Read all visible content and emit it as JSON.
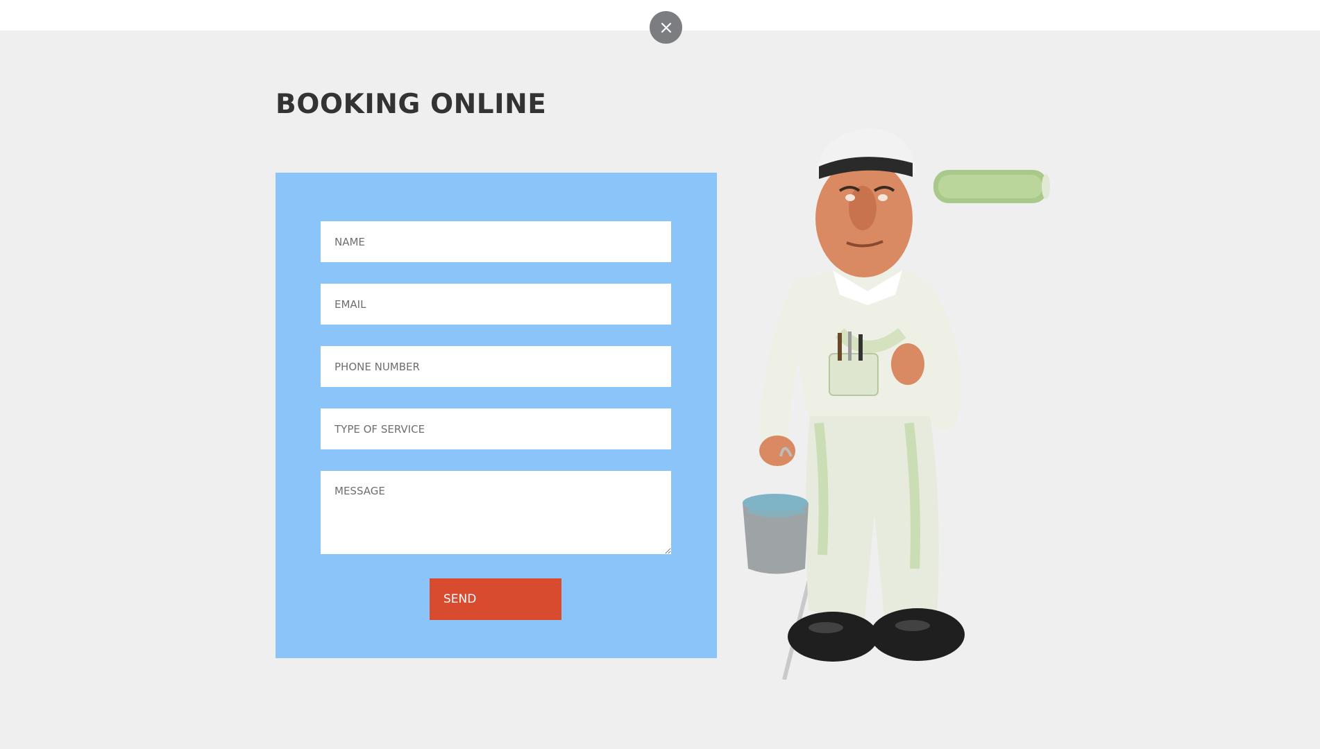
{
  "header": {
    "close_icon": "close-icon"
  },
  "booking": {
    "title": "BOOKING ONLINE",
    "fields": {
      "name_placeholder": "NAME",
      "email_placeholder": "EMAIL",
      "phone_placeholder": "PHONE NUMBER",
      "service_placeholder": "TYPE OF SERVICE",
      "message_placeholder": "MESSAGE"
    },
    "send_label": "SEND"
  },
  "illustration": {
    "subject": "painter-figurine"
  },
  "colors": {
    "page_bg": "#efefef",
    "panel_bg": "#8ac4f9",
    "send_bg": "#d94b2f",
    "close_bg": "#7b7d81",
    "title": "#333333"
  }
}
